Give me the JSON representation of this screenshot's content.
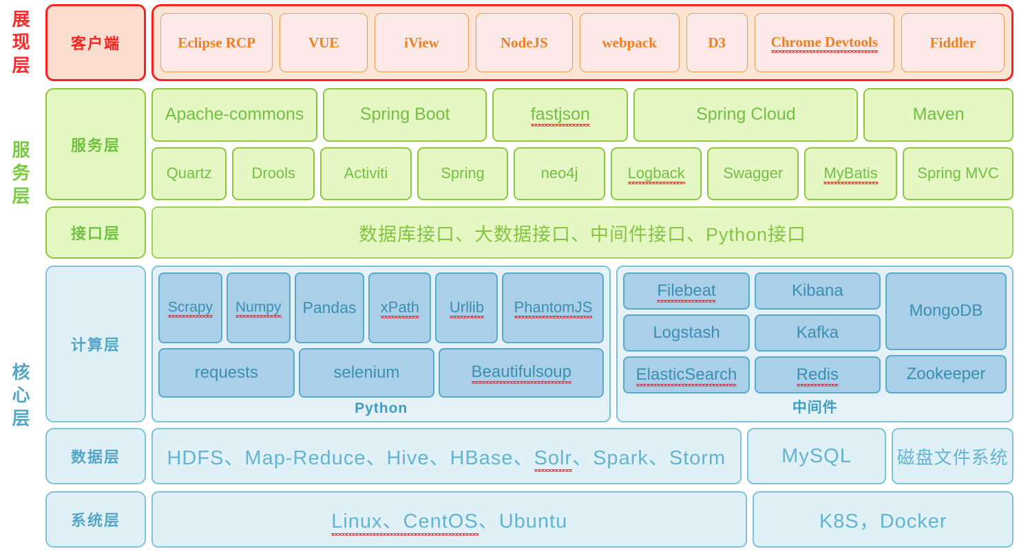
{
  "groups": [
    {
      "id": "presentation",
      "chars": [
        "展",
        "现",
        "层"
      ],
      "color": "#fc2b2b"
    },
    {
      "id": "service",
      "chars": [
        "服",
        "务",
        "层"
      ],
      "color": "#7ac943"
    },
    {
      "id": "core",
      "chars": [
        "核",
        "心",
        "层"
      ],
      "color": "#56a5c4"
    }
  ],
  "layers": {
    "client": {
      "name": "客户端",
      "items": [
        {
          "label": "Eclipse RCP",
          "flex": 1.22,
          "misspelled": false
        },
        {
          "label": "VUE",
          "flex": 0.95,
          "misspelled": false
        },
        {
          "label": "iView",
          "flex": 1.02,
          "misspelled": false
        },
        {
          "label": "NodeJS",
          "flex": 1.05,
          "misspelled": false
        },
        {
          "label": "webpack",
          "flex": 1.08,
          "misspelled": false
        },
        {
          "label": "D3",
          "flex": 0.66,
          "misspelled": false
        },
        {
          "label": "Chrome Devtools",
          "flex": 1.52,
          "misspelled": true
        },
        {
          "label": "Fiddler",
          "flex": 1.12,
          "misspelled": false
        }
      ]
    },
    "service": {
      "name": "服务层",
      "row1": [
        {
          "label": "Apache-commons",
          "flex": 1.62,
          "misspelled": false
        },
        {
          "label": "Spring Boot",
          "flex": 1.6,
          "misspelled": false
        },
        {
          "label": "fastjson",
          "flex": 1.32,
          "misspelled": true
        },
        {
          "label": "Spring Cloud",
          "flex": 2.2,
          "misspelled": false
        },
        {
          "label": "Maven",
          "flex": 1.46,
          "misspelled": false
        }
      ],
      "row2": [
        {
          "label": "Quartz",
          "flex": 0.82,
          "misspelled": false
        },
        {
          "label": "Drools",
          "flex": 0.9,
          "misspelled": false
        },
        {
          "label": "Activiti",
          "flex": 1.0,
          "misspelled": false
        },
        {
          "label": "Spring",
          "flex": 1.0,
          "misspelled": false
        },
        {
          "label": "neo4j",
          "flex": 1.0,
          "misspelled": false
        },
        {
          "label": "Logback",
          "flex": 1.0,
          "misspelled": true
        },
        {
          "label": "Swagger",
          "flex": 1.0,
          "misspelled": false
        },
        {
          "label": "MyBatis",
          "flex": 1.02,
          "misspelled": true
        },
        {
          "label": "Spring MVC",
          "flex": 1.22,
          "misspelled": false
        }
      ]
    },
    "interface": {
      "name": "接口层",
      "content": "数据库接口、大数据接口、中间件接口、Python接口"
    },
    "compute": {
      "name": "计算层",
      "python": {
        "title": "Python",
        "row1": [
          {
            "label": "Scrapy",
            "flex": 1.0,
            "misspelled": true
          },
          {
            "label": "Numpy",
            "flex": 1.0,
            "misspelled": true
          },
          {
            "label": "Pandas",
            "flex": 1.1,
            "misspelled": false
          },
          {
            "label": "xPath",
            "flex": 0.98,
            "misspelled": true
          },
          {
            "label": "Urllib",
            "flex": 0.98,
            "misspelled": true
          },
          {
            "label": "PhantomJS",
            "flex": 1.62,
            "misspelled": true
          }
        ],
        "row2": [
          {
            "label": "requests",
            "flex": 1.0,
            "misspelled": false
          },
          {
            "label": "selenium",
            "flex": 1.0,
            "misspelled": false
          },
          {
            "label": "Beautifulsoup",
            "flex": 1.22,
            "misspelled": true
          }
        ]
      },
      "middleware": {
        "title": "中间件",
        "columns": [
          {
            "width": 1.0,
            "cells": [
              {
                "label": "Filebeat",
                "misspelled": true,
                "span": 1
              },
              {
                "label": "Logstash",
                "misspelled": false,
                "span": 1
              },
              {
                "label": "ElasticSearch",
                "misspelled": true,
                "span": 1
              }
            ]
          },
          {
            "width": 1.0,
            "cells": [
              {
                "label": "Kibana",
                "misspelled": false,
                "span": 1
              },
              {
                "label": "Kafka",
                "misspelled": false,
                "span": 1
              },
              {
                "label": "Redis",
                "misspelled": true,
                "span": 1
              }
            ]
          },
          {
            "width": 0.96,
            "cells": [
              {
                "label": "MongoDB",
                "misspelled": false,
                "span": 2
              },
              {
                "label": "Zookeeper",
                "misspelled": false,
                "span": 1
              }
            ]
          }
        ]
      }
    },
    "data": {
      "name": "数据层",
      "items": [
        {
          "label": "HDFS、Map-Reduce、Hive、HBase、Solr、Spark、Storm",
          "flex": 3.95,
          "misspelled_part": "Solr"
        },
        {
          "label": "MySQL",
          "flex": 0.92,
          "misspelled_part": null
        },
        {
          "label": "磁盘文件系统",
          "flex": 0.8,
          "misspelled_part": null
        }
      ]
    },
    "system": {
      "name": "系统层",
      "items": [
        {
          "label": "Linux、CentOS、Ubuntu",
          "flex": 2.3,
          "misspelled_part": "Linux、CentOS"
        },
        {
          "label": "K8S，Docker",
          "flex": 1.0,
          "misspelled_part": null
        }
      ]
    }
  },
  "colors": {
    "presentation_border": "#fb2121",
    "presentation_text": "#ef7f1f",
    "service_green": "#72bf44",
    "service_fill": "#e5f8c4",
    "core_blue": "#53a6c6",
    "core_fill": "#e0f0f7",
    "chip_fill": "#aacfe8",
    "spellcheck_red": "#e8333a"
  }
}
